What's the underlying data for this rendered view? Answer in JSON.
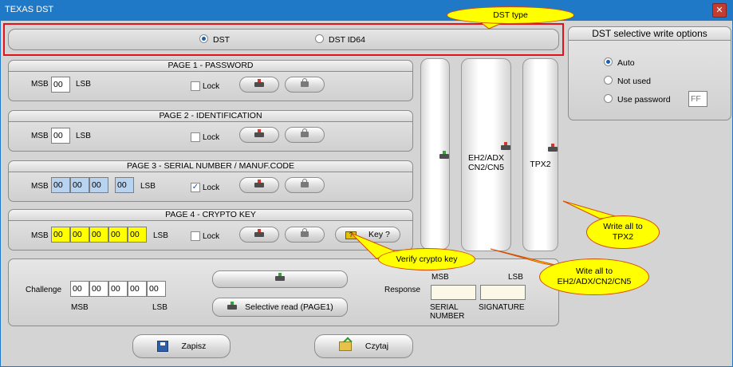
{
  "window": {
    "title": "TEXAS DST",
    "close_glyph": "✕"
  },
  "dst_type": {
    "options": [
      {
        "label": "DST",
        "selected": true
      },
      {
        "label": "DST ID64",
        "selected": false
      }
    ]
  },
  "page1": {
    "title": "PAGE 1 - PASSWORD",
    "msb": "MSB",
    "lsb": "LSB",
    "fields": [
      "00"
    ],
    "lock_label": "Lock",
    "lock_checked": false
  },
  "page2": {
    "title": "PAGE 2 - IDENTIFICATION",
    "msb": "MSB",
    "lsb": "LSB",
    "fields": [
      "00"
    ],
    "lock_label": "Lock",
    "lock_checked": false
  },
  "page3": {
    "title": "PAGE 3 - SERIAL NUMBER  / MANUF.CODE",
    "msb": "MSB",
    "lsb": "LSB",
    "fields": [
      "00",
      "00",
      "00",
      "00"
    ],
    "lock_label": "Lock",
    "lock_checked": true
  },
  "page4": {
    "title": "PAGE 4 - CRYPTO KEY",
    "msb": "MSB",
    "lsb": "LSB",
    "fields": [
      "00",
      "00",
      "00",
      "00",
      "00"
    ],
    "lock_label": "Lock",
    "lock_checked": false,
    "key_button": "Key ?"
  },
  "challenge": {
    "label": "Challenge",
    "fields": [
      "00",
      "00",
      "00",
      "00",
      "00"
    ],
    "msb": "MSB",
    "lsb": "LSB",
    "selective_read": "Selective read (PAGE1)"
  },
  "response": {
    "label": "Response",
    "msb": "MSB",
    "lsb": "LSB",
    "serial_label": "SERIAL\nNUMBER",
    "signature_label": "SIGNATURE",
    "serial_value": "",
    "signature_value": ""
  },
  "write_all": {
    "eh2_label": "EH2/ADX\nCN2/CN5",
    "tpx2_label": "TPX2"
  },
  "selective_write": {
    "title": "DST selective write options",
    "options": [
      {
        "label": "Auto",
        "selected": true
      },
      {
        "label": "Not used",
        "selected": false
      },
      {
        "label": "Use password",
        "selected": false
      }
    ],
    "password_value": "FF"
  },
  "footer": {
    "save_label": "Zapisz",
    "read_label": "Czytaj"
  },
  "callouts": {
    "dst_type": "DST type",
    "verify": "Verify crypto key",
    "tpx2": "Write all to\nTPX2",
    "eh2": "Wite all to\nEH2/ADX/CN2/CN5"
  },
  "colors": {
    "accent": "#1f79c7",
    "callout": "#ffff00",
    "frame": "#e0121b"
  }
}
